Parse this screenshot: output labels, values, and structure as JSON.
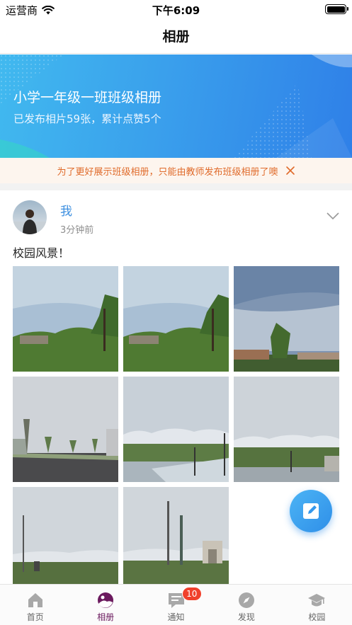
{
  "status_bar": {
    "carrier": "运营商",
    "time": "下午6:09"
  },
  "nav": {
    "title": "相册"
  },
  "banner": {
    "album_title": "小学一年级一班班级相册",
    "album_sub": "已发布相片59张，累计点赞5个"
  },
  "notice": {
    "text": "为了更好展示班级相册，只能由教师发布班级相册了噢"
  },
  "post": {
    "author": "我",
    "time": "3分钟前",
    "text": "校园风景！",
    "photo_count": 8
  },
  "tabs": [
    {
      "label": "首页",
      "icon": "home-icon"
    },
    {
      "label": "相册",
      "icon": "album-icon"
    },
    {
      "label": "通知",
      "icon": "notice-icon",
      "badge": "10"
    },
    {
      "label": "发现",
      "icon": "compass-icon"
    },
    {
      "label": "校园",
      "icon": "campus-icon"
    }
  ],
  "colors": {
    "accent": "#3d8fe0",
    "banner": "#3aa0ec",
    "notice_text": "#e06b2b",
    "tab_active": "#6b1a5e",
    "badge": "#f0402c"
  }
}
